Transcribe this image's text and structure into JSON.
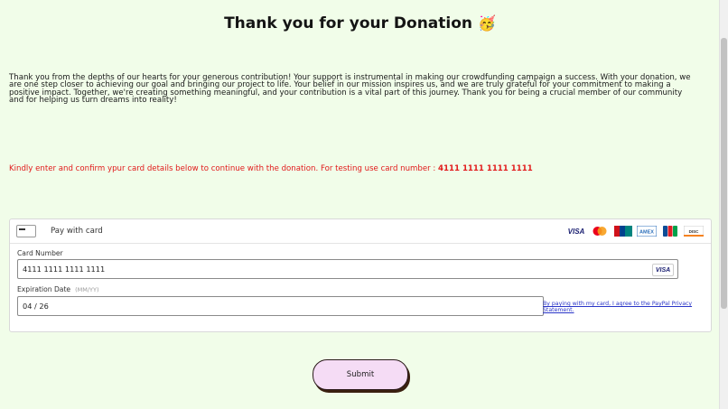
{
  "header": {
    "title": "Thank you for your Donation",
    "emoji": "🥳"
  },
  "message": "Thank you from the depths of our hearts for your generous contribution! Your support is instrumental in making our crowdfunding campaign a success. With your donation, we are one step closer to achieving our goal and bringing our project to life. Your belief in our mission inspires us, and we are truly grateful for your commitment to making a positive impact. Together, we're creating something meaningful, and your contribution is a vital part of this journey. Thank you for being a crucial member of our community and for helping us turn dreams into reality!",
  "notice": {
    "text": "Kindly enter and confirm ypur card details below to continue with the donation. For testing use card number : ",
    "test_card": "4111 1111 1111 1111"
  },
  "card_form": {
    "pay_label": "Pay with card",
    "brands": [
      "VISA",
      "MC",
      "AMEX",
      "UnionPay",
      "JCB",
      "DISCOVER"
    ],
    "card_number": {
      "label": "Card Number",
      "value": "4111 1111 1111 1111",
      "brand": "VISA"
    },
    "expiration": {
      "label": "Expiration Date",
      "hint": "(MM/YY)",
      "value": "04 / 26"
    },
    "privacy_link": "By paying with my card, I agree to the PayPal Privacy Statement."
  },
  "submit_label": "Submit",
  "colors": {
    "background": "#f1fde9",
    "notice": "#e11a1a",
    "button": "#f5dcf5"
  }
}
